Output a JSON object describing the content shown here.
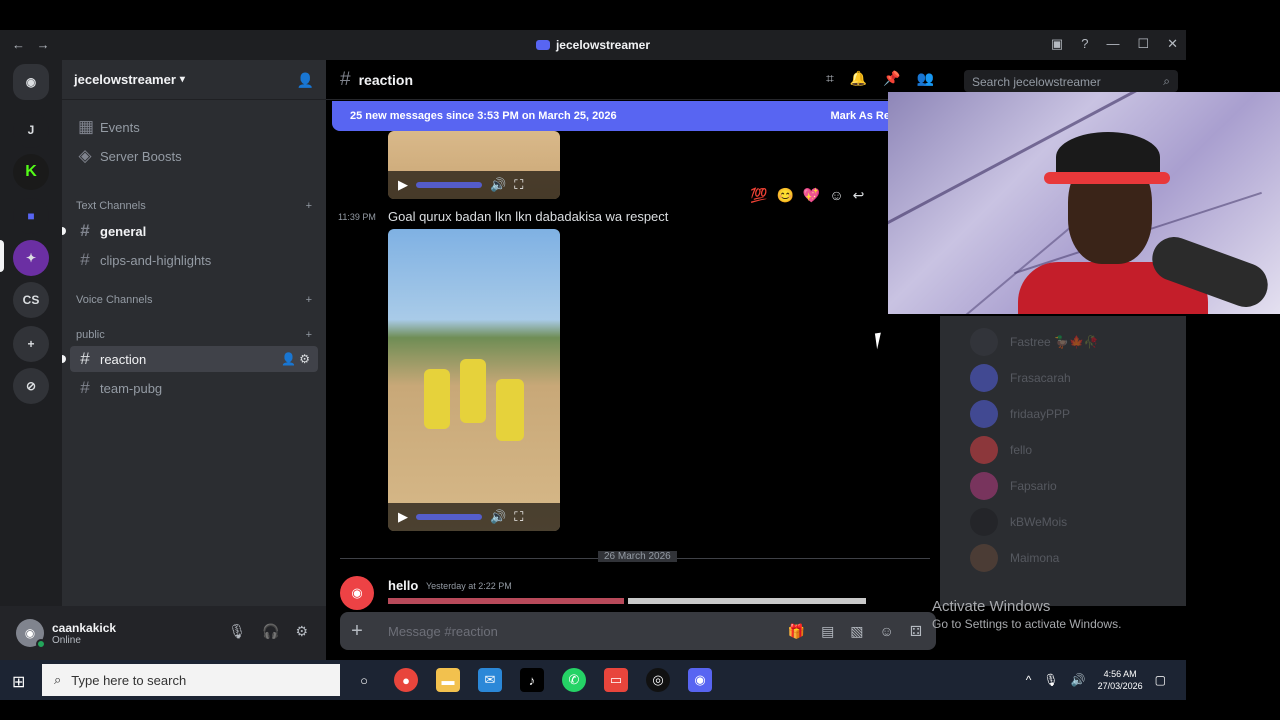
{
  "window": {
    "title": "jecelowstreamer",
    "nav_back": "←",
    "nav_fwd": "→"
  },
  "servers": [
    {
      "label": "J"
    },
    {
      "label": "CS"
    }
  ],
  "guild": {
    "name": "jecelowstreamer",
    "top_items": [
      {
        "label": "Events"
      },
      {
        "label": "Server Boosts"
      }
    ],
    "cat_text": "Text Channels",
    "cat_voice": "Voice Channels",
    "cat_public": "public",
    "text_channels": [
      {
        "label": "general"
      },
      {
        "label": "clips-and-highlights"
      }
    ],
    "public_channels": [
      {
        "label": "reaction"
      },
      {
        "label": "team-pubg"
      }
    ]
  },
  "user": {
    "name": "caankakick",
    "status": "Online"
  },
  "chat": {
    "channel": "reaction",
    "search_placeholder": "Search jecelowstreamer",
    "banner_text": "25 new messages since 3:53 PM on March 25, 2026",
    "banner_action": "Mark As Re",
    "message_time": "11:39 PM",
    "message_text": "Goal qurux badan lkn lkn dabadakisa wa respect",
    "date_divider": "26 March 2026",
    "hello_name": "hello",
    "hello_time": "Yesterday at 2:22 PM",
    "composer_placeholder": "Message #reaction"
  },
  "members": [
    {
      "name": "Fastree 🦆🍁🥀",
      "color": "#3a3c43"
    },
    {
      "name": "Frasacarah",
      "color": "#5865f2"
    },
    {
      "name": "fridaayPPP",
      "color": "#5865f2"
    },
    {
      "name": "fello",
      "color": "#ed4245"
    },
    {
      "name": "Fapsario",
      "color": "#c43c8a"
    },
    {
      "name": "kBWeMois",
      "color": "#1e1f22"
    },
    {
      "name": "Maimona",
      "color": "#6b4c3a"
    }
  ],
  "activate": {
    "line1": "Activate Windows",
    "line2": "Go to Settings to activate Windows."
  },
  "taskbar": {
    "search_placeholder": "Type here to search",
    "time": "4:56 AM",
    "date": "27/03/2026"
  }
}
